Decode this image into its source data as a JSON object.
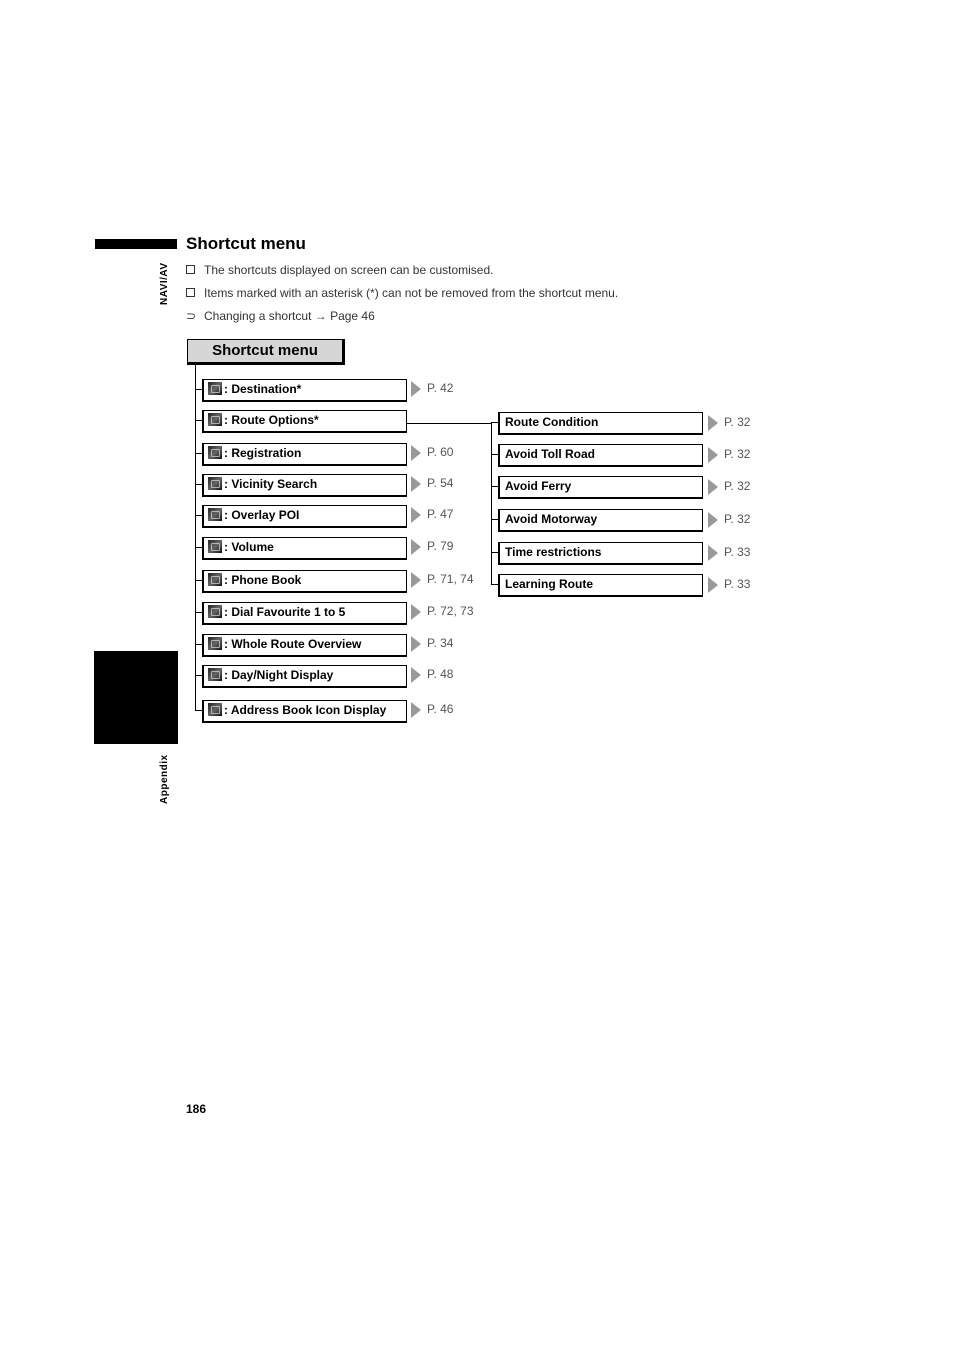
{
  "page": {
    "section_tab": "NAVI/AV",
    "chapter_tab": "Appendix",
    "page_number": "186"
  },
  "heading": "Shortcut menu",
  "notes": [
    {
      "icon": "checkbox-bullet",
      "text": "The shortcuts displayed on screen can be customised."
    },
    {
      "icon": "checkbox-bullet",
      "text": "Items marked with an asterisk (*) can not be removed from the shortcut menu."
    },
    {
      "icon": "arrow-reference",
      "text": "Changing a shortcut → Page 46"
    }
  ],
  "diagram": {
    "root": "Shortcut menu",
    "items": [
      {
        "icon": "destination-icon",
        "label": ": Destination*",
        "ref": "P. 42"
      },
      {
        "icon": "route-options-icon",
        "label": ": Route Options*",
        "ref": ""
      },
      {
        "icon": "registration-icon",
        "label": ": Registration",
        "ref": "P. 60"
      },
      {
        "icon": "vicinity-search-icon",
        "label": ": Vicinity Search",
        "ref": "P. 54"
      },
      {
        "icon": "overlay-poi-icon",
        "label": ": Overlay POI",
        "ref": "P. 47"
      },
      {
        "icon": "volume-icon",
        "label": ": Volume",
        "ref": "P. 79"
      },
      {
        "icon": "phone-book-icon",
        "label": ": Phone Book",
        "ref": "P. 71, 74"
      },
      {
        "icon": "dial-favourite-icon",
        "label": ": Dial Favourite 1 to 5",
        "ref": "P. 72, 73"
      },
      {
        "icon": "whole-route-overview-icon",
        "label": ": Whole Route Overview",
        "ref": "P. 34"
      },
      {
        "icon": "day-night-display-icon",
        "label": ": Day/Night Display",
        "ref": "P. 48"
      },
      {
        "icon": "address-book-icon-display-icon",
        "label": ": Address Book Icon Display",
        "ref": "P. 46"
      }
    ],
    "route_options": [
      {
        "label": "Route Condition",
        "ref": "P. 32"
      },
      {
        "label": "Avoid Toll Road",
        "ref": "P. 32"
      },
      {
        "label": "Avoid Ferry",
        "ref": "P. 32"
      },
      {
        "label": "Avoid Motorway",
        "ref": "P. 32"
      },
      {
        "label": "Time restrictions",
        "ref": "P. 33"
      },
      {
        "label": "Learning Route",
        "ref": "P. 33"
      }
    ]
  }
}
